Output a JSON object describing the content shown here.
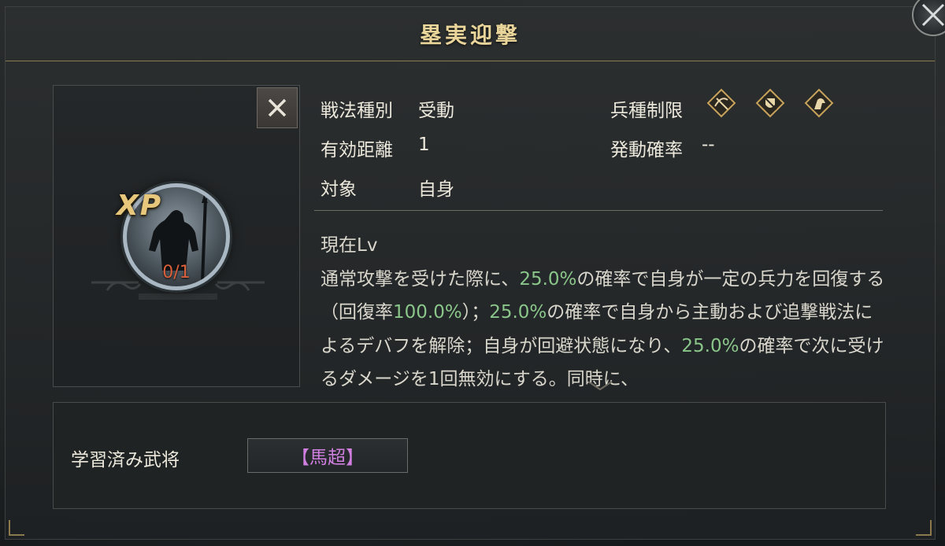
{
  "dialog": {
    "title": "塁実迎撃"
  },
  "skill_icon": {
    "xp_label": "XP",
    "xp_progress": "0/1",
    "remove_glyph": "✕"
  },
  "info": {
    "type_label": "戦法種別",
    "type_value": "受動",
    "range_label": "有効距離",
    "range_value": "1",
    "target_label": "対象",
    "target_value": "自身",
    "unit_label": "兵種制限",
    "unit_icons": [
      "bow-cavalry-icon",
      "shield-infantry-icon",
      "horse-cavalry-icon"
    ],
    "chance_label": "発動確率",
    "chance_value": "--"
  },
  "description": {
    "level_label": "現在Lv",
    "seg1": "通常攻撃を受けた際に、",
    "hl1": "25.0%",
    "seg2": "の確率で自身が一定の兵力を回復する（回復率",
    "hl2": "100.0%",
    "seg3": "）；",
    "hl3": "25.0%",
    "seg4": "の確率で自身から主動および追撃戦法によるデバフを解除；自身が回避状態になり、",
    "hl4": "25.0%",
    "seg5": "の確率で次に受けるダメージを1回無効にする。同時に、"
  },
  "learned": {
    "label": "学習済み武将",
    "general": "【馬超】"
  },
  "colors": {
    "accent_gold": "#e9d49a",
    "highlight_green": "#8ac68a",
    "general_purple": "#d07fe0",
    "xp_red": "#d9603a"
  }
}
